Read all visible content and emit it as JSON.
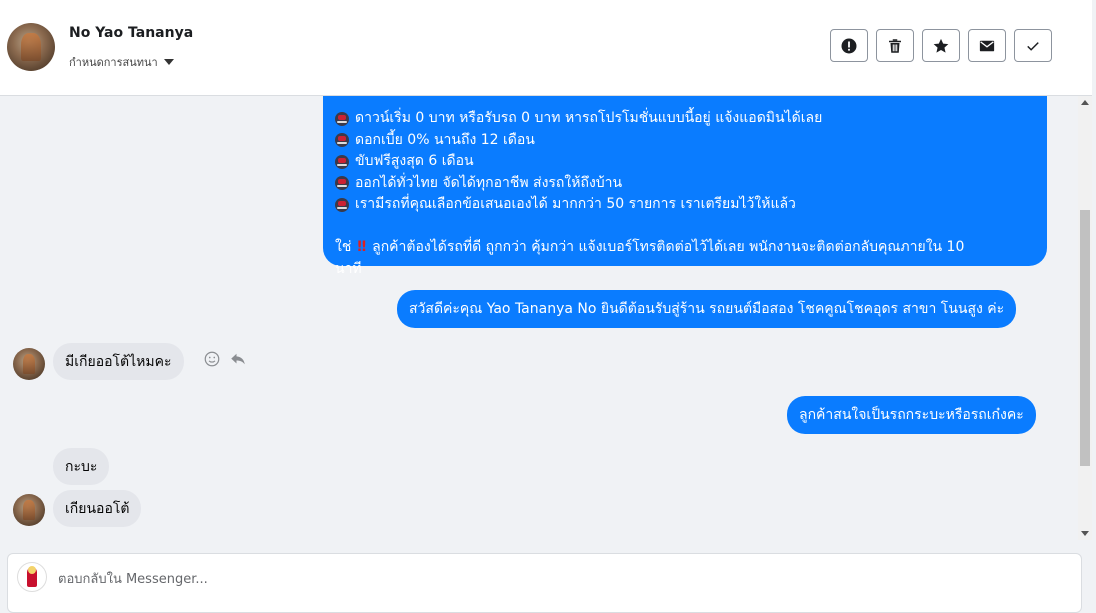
{
  "header": {
    "contact_name": "No Yao Tananya",
    "contact_subtitle": "กำหนดการสนทนา"
  },
  "actions": [
    {
      "icon": "alert-icon"
    },
    {
      "icon": "trash-icon"
    },
    {
      "icon": "star-icon"
    },
    {
      "icon": "mail-icon"
    },
    {
      "icon": "check-icon"
    }
  ],
  "messages": {
    "promo_lines": [
      "ดาวน์เริ่ม 0 บาท หรือรับรถ 0 บาท หารถโปรโมชั่นแบบนี้อยู่ แจ้งแอดมินได้เลย",
      "ดอกเบี้ย 0% นานถึง 12 เดือน",
      "ขับฟรีสูงสุด 6 เดือน",
      "ออกได้ทั่วไทย จัดได้ทุกอาชีพ ส่งรถให้ถึงบ้าน",
      "เรามีรถที่คุณเลือกข้อเสนอเองได้ มากกว่า 50 รายการ เราเตรียมไว้ให้แล้ว"
    ],
    "promo_footer_a": "ใช่",
    "promo_footer_b": "ลูกค้าต้องได้รถที่ดี ถูกกว่า คุ้มกว่า แจ้งเบอร์โทรติดต่อไว้ได้เลย พนักงานจะติดต่อกลับคุณภายใน 10",
    "promo_footer_c": "นาที",
    "greeting": "สวัสดีค่ะคุณ Yao Tananya No ยินดีต้อนรับสู่ร้าน รถยนต์มือสอง โชคคูณโชคอุดร สาขา โนนสูง ค่ะ",
    "incoming_1": "มีเกียออโต้ไหมคะ",
    "outgoing_ask": "ลูกค้าสนใจเป็นรถกระบะหรือรถเก๋งคะ",
    "incoming_2": "กะบะ",
    "incoming_3": "เกียนออโต้"
  },
  "composer": {
    "placeholder": "ตอบกลับใน Messenger..."
  },
  "colors": {
    "outgoing_bubble": "#0a7cff",
    "incoming_bubble": "#e4e6eb",
    "background": "#f0f2f5"
  }
}
